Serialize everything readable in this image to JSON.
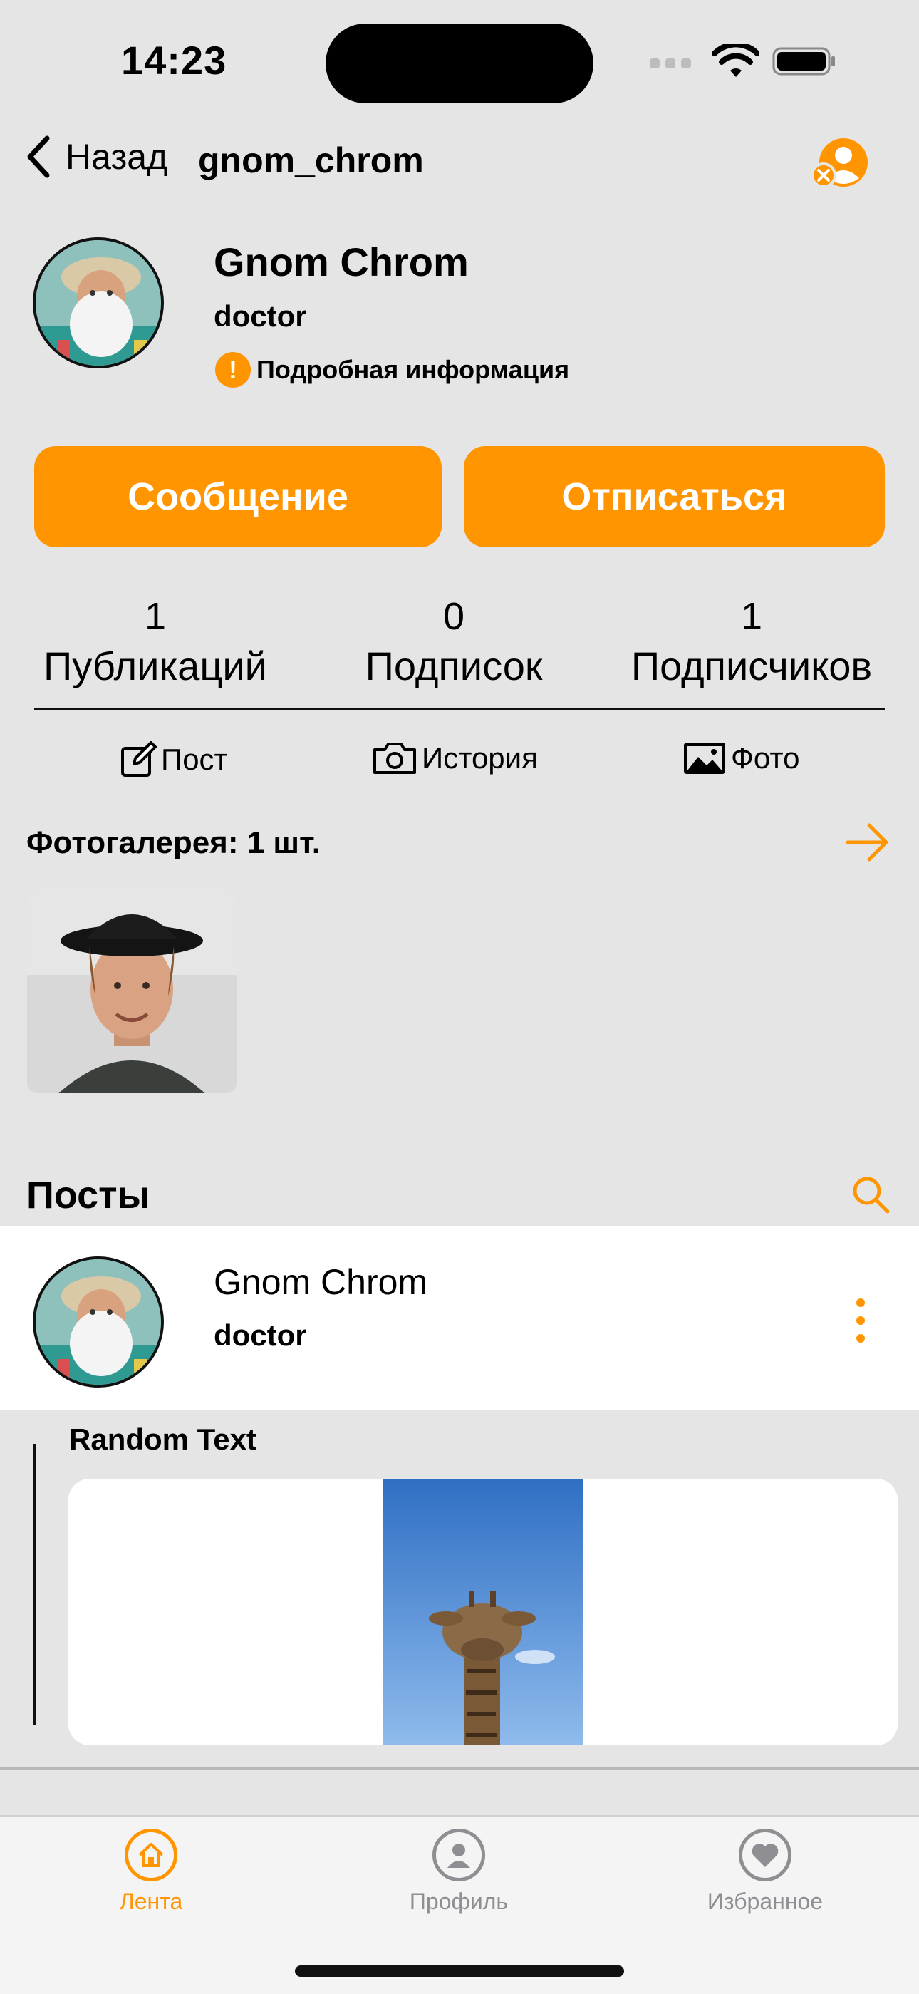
{
  "status_bar": {
    "time": "14:23"
  },
  "nav": {
    "back_label": "Назад",
    "title": "gnom_chrom"
  },
  "profile": {
    "name": "Gnom Chrom",
    "role": "doctor",
    "info_link": "Подробная информация"
  },
  "actions": {
    "message": "Сообщение",
    "unsubscribe": "Отписаться"
  },
  "stats": [
    {
      "value": "1",
      "label": "Публикаций"
    },
    {
      "value": "0",
      "label": "Подписок"
    },
    {
      "value": "1",
      "label": "Подписчиков"
    }
  ],
  "create": {
    "post": "Пост",
    "story": "История",
    "photo": "Фото"
  },
  "gallery": {
    "title": "Фотогалерея: 1 шт."
  },
  "posts": {
    "title": "Посты",
    "items": [
      {
        "author": "Gnom Chrom",
        "role": "doctor",
        "text": "Random Text"
      }
    ]
  },
  "tabbar": {
    "items": [
      {
        "label": "Лента",
        "active": true
      },
      {
        "label": "Профиль",
        "active": false
      },
      {
        "label": "Избранное",
        "active": false
      }
    ]
  },
  "colors": {
    "accent": "#ff9500",
    "background": "#e5e5e5",
    "card": "#ffffff"
  }
}
